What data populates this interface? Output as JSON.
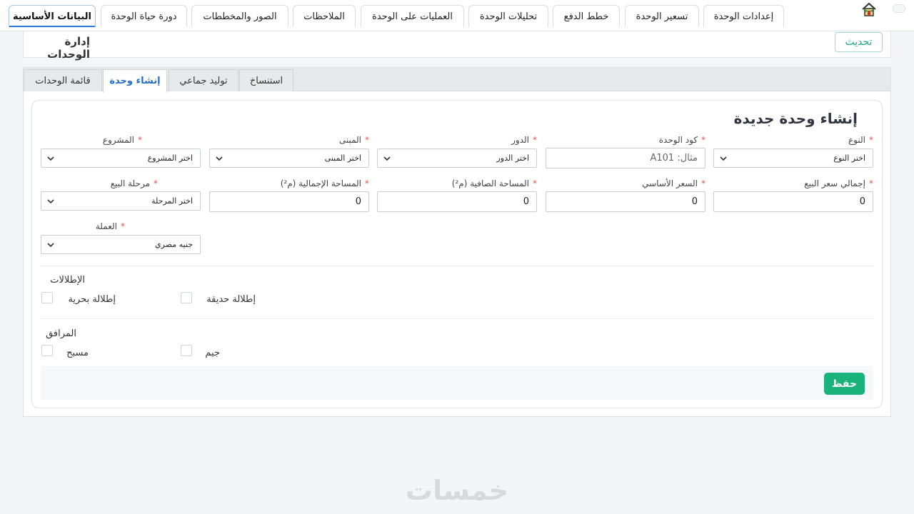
{
  "top_tabs": [
    {
      "label": "البيانات الأساسية",
      "active": true
    },
    {
      "label": "دورة حياة الوحدة"
    },
    {
      "label": "الصور والمخططات"
    },
    {
      "label": "الملاحظات"
    },
    {
      "label": "العمليات على الوحدة"
    },
    {
      "label": "تحليلات الوحدة"
    },
    {
      "label": "خطط الدفع"
    },
    {
      "label": "تسعير الوحدة"
    },
    {
      "label": "إعدادات الوحدة"
    }
  ],
  "header": {
    "title": "إدارة الوحدات",
    "refresh_label": "تحديث"
  },
  "sub_tabs": [
    {
      "label": "قائمة الوحدات"
    },
    {
      "label": "إنشاء وحدة",
      "active": true
    },
    {
      "label": "توليد جماعي"
    },
    {
      "label": "استنساخ"
    }
  ],
  "form": {
    "title": "إنشاء وحدة جديدة",
    "required_mark": "*",
    "fields": {
      "type": {
        "label": "النوع",
        "value": "اختر النوع"
      },
      "unit_code": {
        "label": "كود الوحدة",
        "placeholder": "مثال: A101"
      },
      "floor": {
        "label": "الدور",
        "value": "اختر الدور"
      },
      "building": {
        "label": "المبنى",
        "value": "اختر المبنى"
      },
      "project": {
        "label": "المشروع",
        "value": "اختر المشروع"
      },
      "total_sale_price": {
        "label": "إجمالي سعر البيع",
        "value": "0"
      },
      "base_price": {
        "label": "السعر الأساسي",
        "value": "0"
      },
      "net_area": {
        "label": "المساحة الصافية (م²)",
        "value": "0"
      },
      "gross_area": {
        "label": "المساحة الإجمالية (م²)",
        "value": "0"
      },
      "sale_phase": {
        "label": "مرحلة البيع",
        "value": "اختر المرحلة"
      },
      "currency": {
        "label": "العملة",
        "value": "جنيه مصري"
      }
    },
    "views": {
      "title": "الإطلالات",
      "items": [
        {
          "label": "إطلالة بحرية",
          "checked": false
        },
        {
          "label": "إطلالة حديقة",
          "checked": false
        }
      ]
    },
    "amenities": {
      "title": "المرافق",
      "items": [
        {
          "label": "مسبح",
          "checked": false
        },
        {
          "label": "جيم",
          "checked": false
        }
      ]
    },
    "save_label": "حفظ"
  },
  "watermark": "خمسات",
  "colors": {
    "accent": "#19b27b",
    "active_tab": "#1f6fc6",
    "required": "#e05252"
  },
  "icons": {
    "home": "home-icon",
    "chevron": "chevron-down-icon"
  }
}
